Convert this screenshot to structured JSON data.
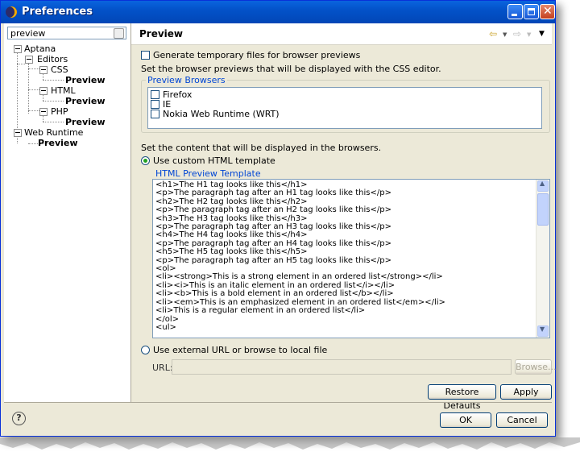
{
  "window": {
    "title": "Preferences"
  },
  "filter": {
    "value": "preview"
  },
  "tree": {
    "aptana": "Aptana",
    "editors": "Editors",
    "css": "CSS",
    "css_preview": "Preview",
    "html": "HTML",
    "html_preview": "Preview",
    "php": "PHP",
    "php_preview": "Preview",
    "web_runtime": "Web Runtime",
    "wr_preview": "Preview"
  },
  "page": {
    "title": "Preview",
    "gen_temp_label": "Generate temporary files for browser previews",
    "browsers_desc": "Set the browser previews that will be displayed with the CSS editor.",
    "browsers_group": "Preview Browsers",
    "browsers": [
      "Firefox",
      "IE",
      "Nokia Web Runtime (WRT)"
    ],
    "content_desc": "Set the content that will be displayed in the browsers.",
    "custom_template_label": "Use custom HTML template",
    "template_group": "HTML Preview Template",
    "template_lines": [
      "<h1>The H1 tag looks like this</h1>",
      "<p>The paragraph tag after an H1 tag looks like this</p>",
      "<h2>The H2 tag looks like this</h2>",
      "<p>The paragraph tag after an H2 tag looks like this</p>",
      "<h3>The H3 tag looks like this</h3>",
      "<p>The paragraph tag after an H3 tag looks like this</p>",
      "<h4>The H4 tag looks like this</h4>",
      "<p>The paragraph tag after an H4 tag looks like this</p>",
      "<h5>The H5 tag looks like this</h5>",
      "<p>The paragraph tag after an H5 tag looks like this</p>",
      "<ol>",
      "<li><strong>This is a strong element in an ordered list</strong></li>",
      "<li><i>This is an italic element in an ordered list</i></li>",
      "<li><b>This is a bold element in an ordered list</b></li>",
      "<li><em>This is an emphasized element in an ordered list</em></li>",
      "<li>This is a regular element in an ordered list</li>",
      "</ol>",
      "<ul>"
    ],
    "external_url_label": "Use external URL or browse to local file",
    "url_label": "URL:",
    "url_value": "",
    "browse_label": "Browse...",
    "restore_label": "Restore Defaults",
    "apply_label": "Apply"
  },
  "dialog": {
    "ok_label": "OK",
    "cancel_label": "Cancel"
  },
  "icons": {
    "help": "?",
    "back": "⇦",
    "forward": "⇨",
    "menu": "▼"
  }
}
